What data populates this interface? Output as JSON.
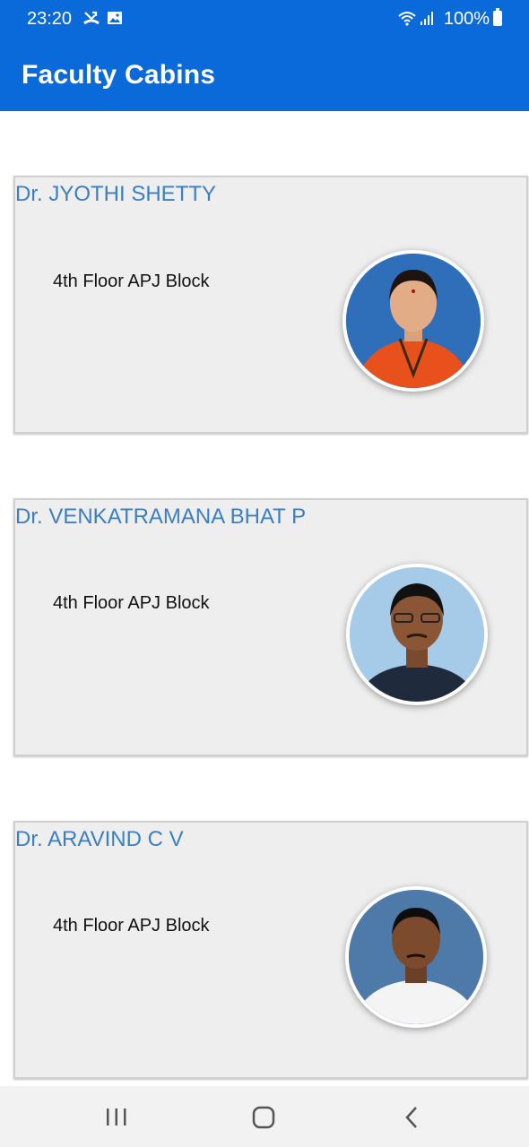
{
  "status_bar": {
    "time": "23:20",
    "battery": "100%",
    "icons": [
      "missed-call-icon",
      "image-icon",
      "wifi-icon",
      "signal-icon",
      "battery-icon"
    ]
  },
  "app_bar": {
    "title": "Faculty Cabins",
    "color": "#0b6ad9"
  },
  "faculty": [
    {
      "name": "Dr. JYOTHI SHETTY",
      "location": "4th Floor APJ Block"
    },
    {
      "name": "Dr. VENKATRAMANA BHAT P",
      "location": "4th Floor APJ Block"
    },
    {
      "name": "Dr. ARAVIND C V",
      "location": "4th Floor APJ Block"
    }
  ],
  "nav_bar": {
    "buttons": [
      "recents-icon",
      "home-icon",
      "back-icon"
    ]
  }
}
